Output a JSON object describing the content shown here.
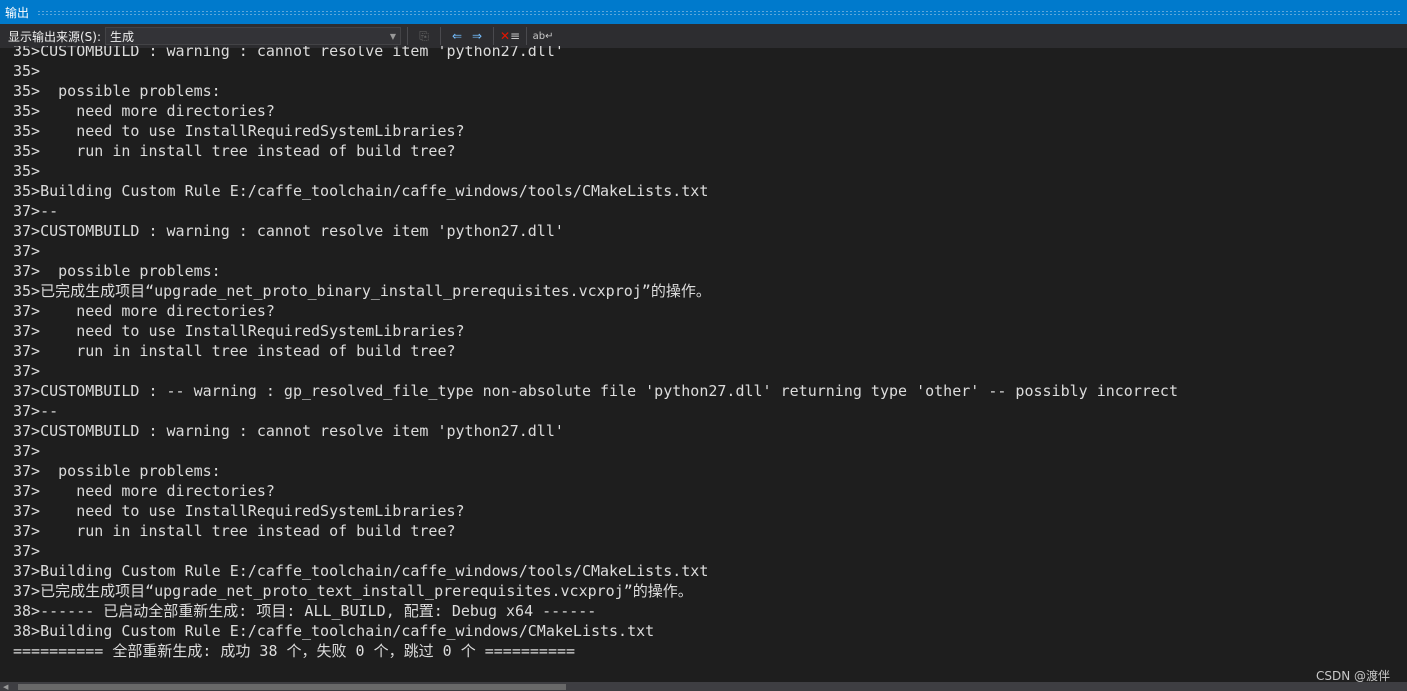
{
  "window": {
    "title": "输出"
  },
  "toolbar": {
    "source_label": "显示输出来源(S):",
    "source_value": "生成",
    "icons": [
      "find-message-icon",
      "previous-message-icon",
      "next-message-icon",
      "clear-all-icon",
      "word-wrap-icon"
    ]
  },
  "lines": [
    "35>CUSTOMBUILD : warning : cannot resolve item 'python27.dll'",
    "35>",
    "35>  possible problems:",
    "35>    need more directories?",
    "35>    need to use InstallRequiredSystemLibraries?",
    "35>    run in install tree instead of build tree?",
    "35>",
    "35>Building Custom Rule E:/caffe_toolchain/caffe_windows/tools/CMakeLists.txt",
    "37>--",
    "37>CUSTOMBUILD : warning : cannot resolve item 'python27.dll'",
    "37>",
    "37>  possible problems:",
    "35>已完成生成项目“upgrade_net_proto_binary_install_prerequisites.vcxproj”的操作。",
    "37>    need more directories?",
    "37>    need to use InstallRequiredSystemLibraries?",
    "37>    run in install tree instead of build tree?",
    "37>",
    "37>CUSTOMBUILD : -- warning : gp_resolved_file_type non-absolute file 'python27.dll' returning type 'other' -- possibly incorrect",
    "37>--",
    "37>CUSTOMBUILD : warning : cannot resolve item 'python27.dll'",
    "37>",
    "37>  possible problems:",
    "37>    need more directories?",
    "37>    need to use InstallRequiredSystemLibraries?",
    "37>    run in install tree instead of build tree?",
    "37>",
    "37>Building Custom Rule E:/caffe_toolchain/caffe_windows/tools/CMakeLists.txt",
    "37>已完成生成项目“upgrade_net_proto_text_install_prerequisites.vcxproj”的操作。",
    "38>------ 已启动全部重新生成: 项目: ALL_BUILD, 配置: Debug x64 ------",
    "38>Building Custom Rule E:/caffe_toolchain/caffe_windows/CMakeLists.txt",
    "========== 全部重新生成: 成功 38 个，失败 0 个，跳过 0 个 =========="
  ],
  "watermark": "CSDN @渡伴",
  "colors": {
    "accent": "#007acc",
    "background": "#1e1e1e",
    "text": "#dcdcdc"
  }
}
